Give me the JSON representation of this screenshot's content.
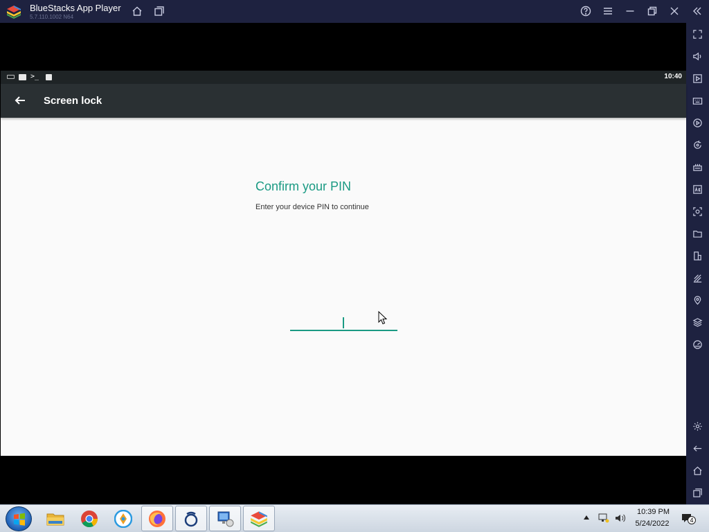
{
  "window": {
    "title": "BlueStacks App Player",
    "version": "5.7.110.1002  N64"
  },
  "titlebar_icons": [
    "home-icon",
    "multi-instance-icon",
    "help-icon",
    "menu-icon",
    "minimize-icon",
    "restore-icon",
    "close-icon",
    "collapse-sidebar-icon"
  ],
  "sidebar_icons": [
    "fullscreen-icon",
    "volume-icon",
    "media-icon",
    "keyboard-icon",
    "record-icon",
    "rotate-icon",
    "macro-icon",
    "apk-install-icon",
    "screenshot-icon",
    "folder-icon",
    "multi-instance-icon",
    "eco-mode-icon",
    "location-icon",
    "layers-icon",
    "performance-icon",
    "settings-icon",
    "back-icon",
    "home-icon",
    "recent-apps-icon"
  ],
  "android": {
    "status_bar": {
      "time": "10:40"
    },
    "app_bar": {
      "title": "Screen lock"
    },
    "pin": {
      "heading": "Confirm your PIN",
      "subtext": "Enter your device PIN to continue",
      "value": ""
    }
  },
  "taskbar": {
    "apps": [
      "windows-explorer-icon",
      "chrome-icon",
      "browser-icon",
      "firefox-icon",
      "app-icon",
      "remote-desktop-icon",
      "bluestacks-icon"
    ],
    "time": "10:39 PM",
    "date": "5/24/2022",
    "notification_count": "4"
  },
  "colors": {
    "accent": "#1a9a83",
    "chrome_bg": "#1e2240",
    "app_bar": "#2a3033"
  }
}
